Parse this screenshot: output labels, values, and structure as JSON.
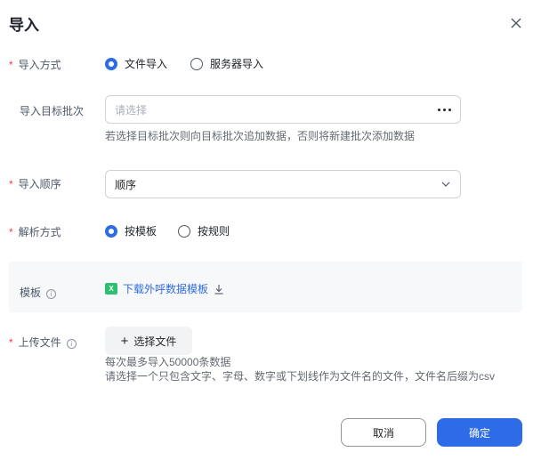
{
  "dialog": {
    "title": "导入"
  },
  "import_method": {
    "label": "导入方式",
    "required_mark": "*",
    "options": [
      {
        "label": "文件导入",
        "checked": true
      },
      {
        "label": "服务器导入",
        "checked": false
      }
    ]
  },
  "target_batch": {
    "label": "导入目标批次",
    "placeholder": "请选择",
    "hint": "若选择目标批次则向目标批次追加数据，否则将新建批次添加数据"
  },
  "import_order": {
    "label": "导入顺序",
    "required_mark": "*",
    "value": "顺序"
  },
  "parse_method": {
    "label": "解析方式",
    "required_mark": "*",
    "options": [
      {
        "label": "按模板",
        "checked": true
      },
      {
        "label": "按规则",
        "checked": false
      }
    ]
  },
  "template": {
    "label": "模板",
    "icon_letter": "X",
    "link_text": "下载外呼数据模板"
  },
  "upload": {
    "label": "上传文件",
    "required_mark": "*",
    "button_label": "选择文件",
    "hint_line1": "每次最多导入50000条数据",
    "hint_line2": "请选择一个只包含文字、字母、数字或下划线作为文件名的文件，文件名后缀为csv"
  },
  "footer": {
    "cancel_label": "取消",
    "ok_label": "确定"
  },
  "colors": {
    "accent": "#2e6be6",
    "required": "#f53f3f",
    "excel": "#2fbf71"
  }
}
